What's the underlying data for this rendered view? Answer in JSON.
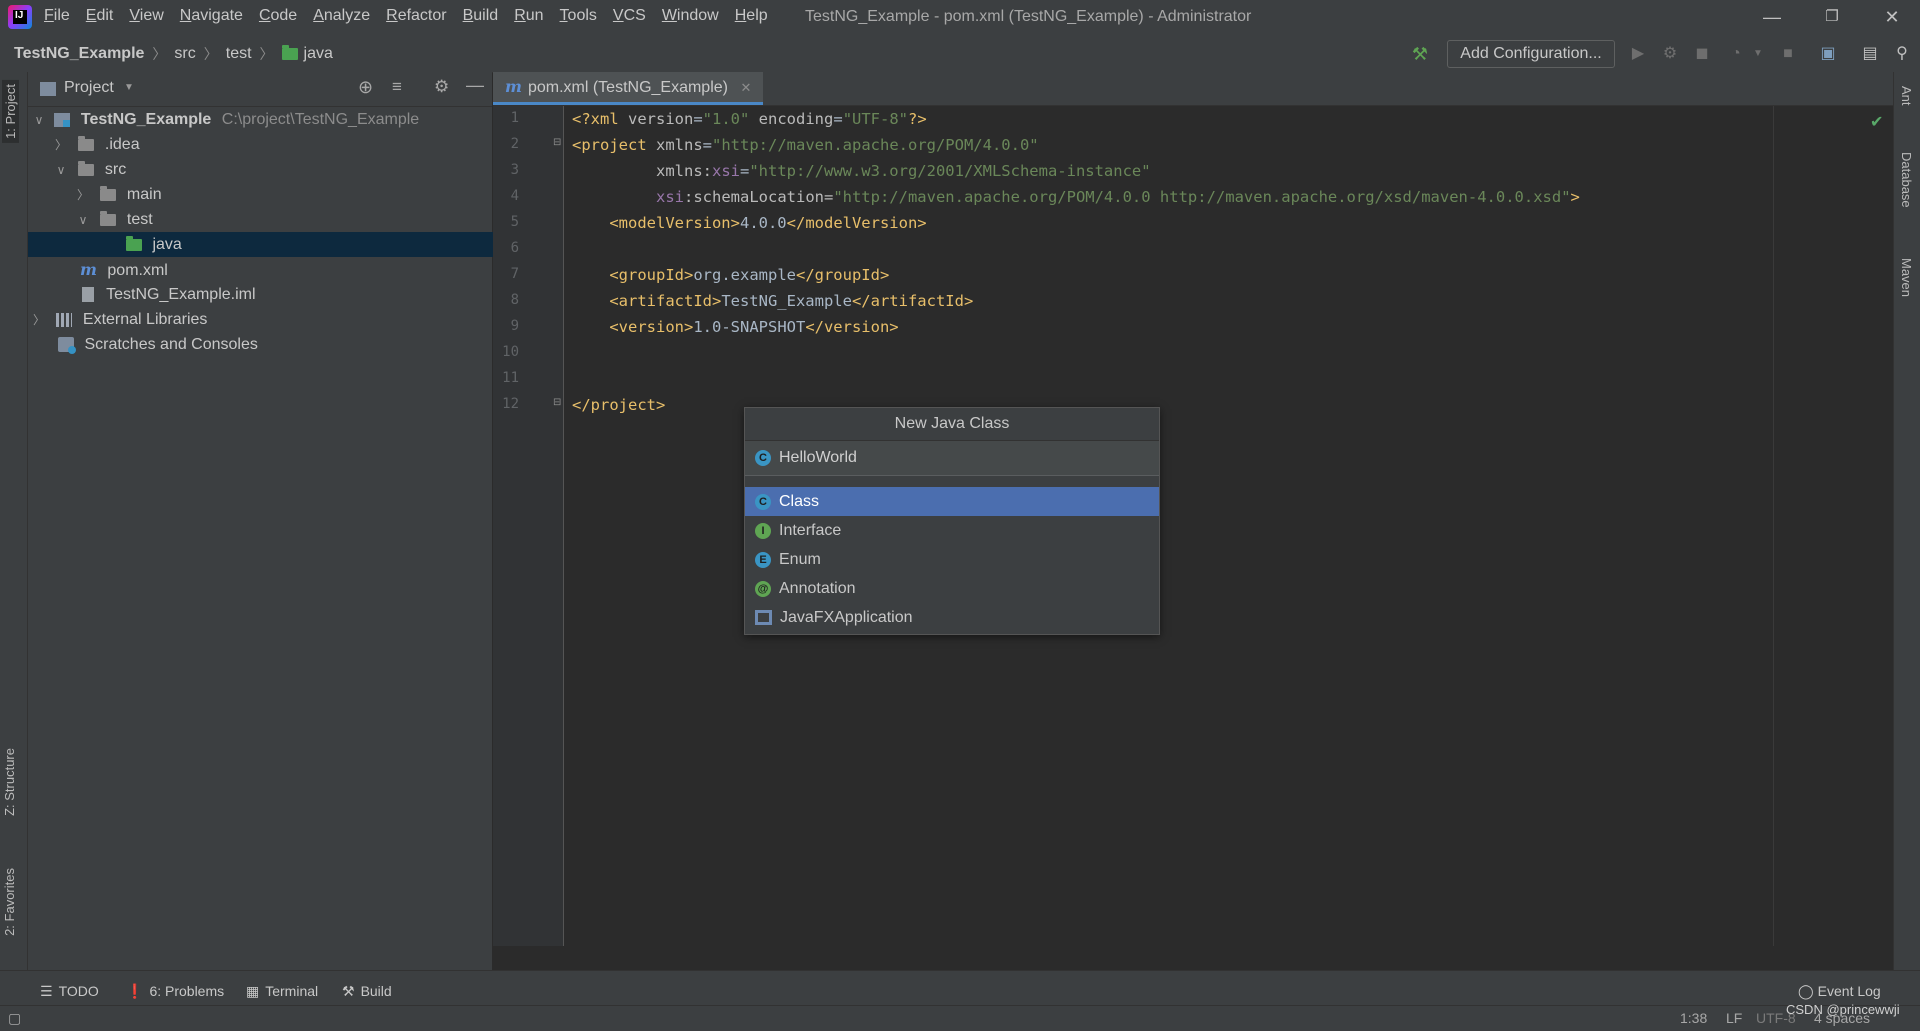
{
  "menu": [
    "File",
    "Edit",
    "View",
    "Navigate",
    "Code",
    "Analyze",
    "Refactor",
    "Build",
    "Run",
    "Tools",
    "VCS",
    "Window",
    "Help"
  ],
  "window_title": "TestNG_Example - pom.xml (TestNG_Example) - Administrator",
  "breadcrumb": [
    "TestNG_Example",
    "src",
    "test",
    "java"
  ],
  "toolbar": {
    "add_config_label": "Add Configuration..."
  },
  "left_tabs": {
    "project": "1: Project",
    "structure": "Z: Structure",
    "favorites": "2: Favorites"
  },
  "right_tabs": {
    "ant": "Ant",
    "database": "Database",
    "maven": "Maven"
  },
  "project_panel": {
    "header": "Project",
    "tree": [
      {
        "label": "TestNG_Example",
        "path": "C:\\project\\TestNG_Example",
        "expanded": true
      },
      {
        "label": ".idea",
        "expanded": false
      },
      {
        "label": "src",
        "expanded": true
      },
      {
        "label": "main",
        "expanded": false
      },
      {
        "label": "test",
        "expanded": true
      },
      {
        "label": "java",
        "selected": true
      },
      {
        "label": "pom.xml"
      },
      {
        "label": "TestNG_Example.iml"
      },
      {
        "label": "External Libraries",
        "expanded": false
      },
      {
        "label": "Scratches and Consoles"
      }
    ]
  },
  "editor": {
    "tab_label": "pom.xml (TestNG_Example)",
    "line_numbers": [
      "1",
      "2",
      "3",
      "4",
      "5",
      "6",
      "7",
      "8",
      "9",
      "10",
      "11",
      "12"
    ],
    "lines": {
      "l1": {
        "a": "<?xml ",
        "b": "version",
        "c": "=",
        "d": "\"1.0\"",
        "e": " encoding",
        "f": "=",
        "g": "\"UTF-8\"",
        "h": "?>"
      },
      "l2": {
        "a": "<project ",
        "b": "xmlns",
        "c": "=",
        "d": "\"http://maven.apache.org/POM/4.0.0\""
      },
      "l3": {
        "a": "         xmlns:",
        "b": "xsi",
        "c": "=",
        "d": "\"http://www.w3.org/2001/XMLSchema-instance\""
      },
      "l4": {
        "a": "         ",
        "b": "xsi",
        "c": ":schemaLocation=",
        "d": "\"http://maven.apache.org/POM/4.0.0 http://maven.apache.org/xsd/maven-4.0.0.xsd\"",
        "e": ">"
      },
      "l5": {
        "a": "    <modelVersion>",
        "b": "4.0.0",
        "c": "</modelVersion>"
      },
      "l7": {
        "a": "    <groupId>",
        "b": "org.example",
        "c": "</groupId>"
      },
      "l8": {
        "a": "    <artifactId>",
        "b": "TestNG_Example",
        "c": "</artifactId>"
      },
      "l9": {
        "a": "    <version>",
        "b": "1.0-SNAPSHOT",
        "c": "</version>"
      },
      "l12": {
        "a": "</project>"
      }
    }
  },
  "popup": {
    "title": "New Java Class",
    "input_value": "HelloWorld",
    "items": [
      {
        "label": "Class",
        "icon": "C",
        "color": "#3a95c4",
        "selected": true
      },
      {
        "label": "Interface",
        "icon": "I",
        "color": "#5fa553"
      },
      {
        "label": "Enum",
        "icon": "E",
        "color": "#3a95c4"
      },
      {
        "label": "Annotation",
        "icon": "@",
        "color": "#5fa553"
      },
      {
        "label": "JavaFXApplication",
        "icon": "fx",
        "color": "#6d8ab3"
      }
    ]
  },
  "bottom_tools": [
    "TODO",
    "6: Problems",
    "Terminal",
    "Build"
  ],
  "status": {
    "event_log": "Event Log",
    "position": "1:38",
    "line_sep": "LF",
    "encoding": "UTF-8",
    "indent": "4 spaces",
    "watermark": "CSDN @princewwji"
  }
}
